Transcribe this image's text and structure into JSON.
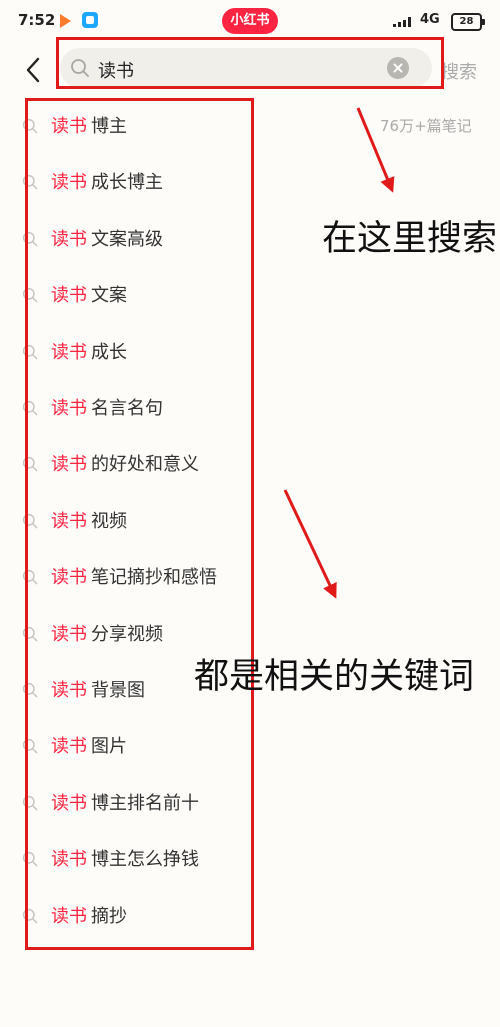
{
  "status_bar": {
    "time": "7:52",
    "brand": "小红书",
    "network": "4G",
    "battery": "28"
  },
  "search": {
    "query": "读书",
    "submit_label": "搜索",
    "note_count": "76万+篇笔记"
  },
  "suggestions": [
    {
      "keyword": "读书",
      "rest": "博主"
    },
    {
      "keyword": "读书",
      "rest": "成长博主"
    },
    {
      "keyword": "读书",
      "rest": "文案高级"
    },
    {
      "keyword": "读书",
      "rest": "文案"
    },
    {
      "keyword": "读书",
      "rest": "成长"
    },
    {
      "keyword": "读书",
      "rest": "名言名句"
    },
    {
      "keyword": "读书",
      "rest": "的好处和意义"
    },
    {
      "keyword": "读书",
      "rest": "视频"
    },
    {
      "keyword": "读书",
      "rest": "笔记摘抄和感悟"
    },
    {
      "keyword": "读书",
      "rest": "分享视频"
    },
    {
      "keyword": "读书",
      "rest": "背景图"
    },
    {
      "keyword": "读书",
      "rest": "图片"
    },
    {
      "keyword": "读书",
      "rest": "博主排名前十"
    },
    {
      "keyword": "读书",
      "rest": "博主怎么挣钱"
    },
    {
      "keyword": "读书",
      "rest": "摘抄"
    }
  ],
  "annotations": {
    "search_here": "在这里搜索",
    "related_keywords": "都是相关的关键词"
  },
  "colors": {
    "accent": "#ff2442",
    "annotation_red": "#e01a1a"
  },
  "icons": {
    "back": "chevron-left-icon",
    "search": "search-icon",
    "clear": "clear-icon"
  }
}
